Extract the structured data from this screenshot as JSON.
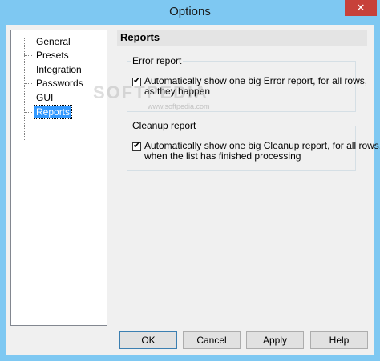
{
  "window": {
    "title": "Options",
    "close_glyph": "✕"
  },
  "tree": {
    "items": [
      {
        "label": "General",
        "selected": false
      },
      {
        "label": "Presets",
        "selected": false
      },
      {
        "label": "Integration",
        "selected": false
      },
      {
        "label": "Passwords",
        "selected": false
      },
      {
        "label": "GUI",
        "selected": false
      },
      {
        "label": "Reports",
        "selected": true
      }
    ]
  },
  "panel": {
    "header": "Reports",
    "error_group": {
      "label": "Error report",
      "checkbox_checked": true,
      "line1": "Automatically show one big Error report, for all rows,",
      "line2": "as they happen"
    },
    "cleanup_group": {
      "label": "Cleanup report",
      "checkbox_checked": true,
      "line1": "Automatically show one big Cleanup report, for all rows,",
      "line2": "when the list has finished processing"
    }
  },
  "watermark": {
    "main": "SOFTPEDIA",
    "sub": "www.softpedia.com"
  },
  "buttons": {
    "ok": "OK",
    "cancel": "Cancel",
    "apply": "Apply",
    "help": "Help"
  }
}
